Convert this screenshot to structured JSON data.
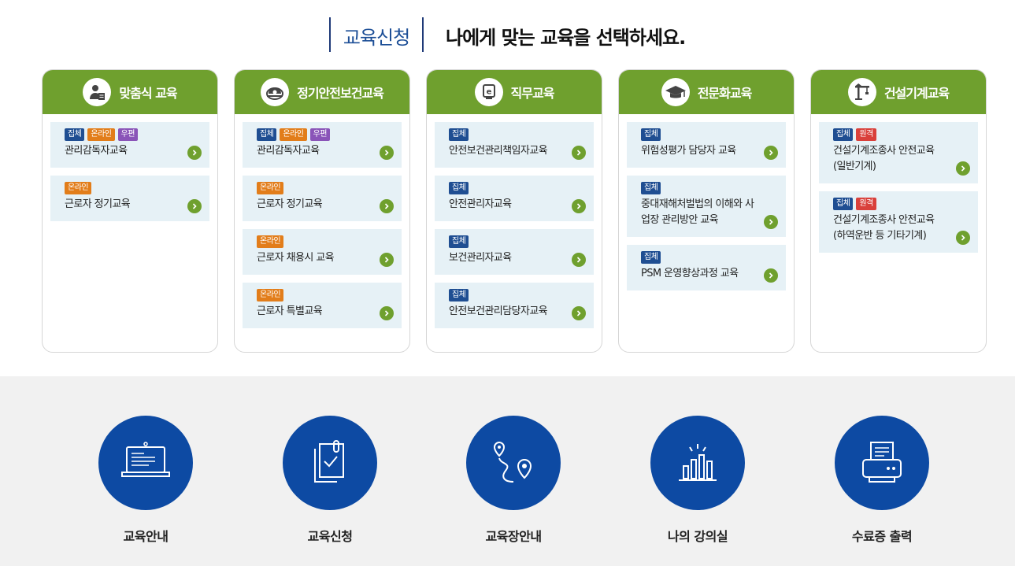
{
  "heading": {
    "label": "교육신청",
    "title": "나에게 맞는 교육을 선택하세요."
  },
  "colors": {
    "accent_green": "#6fa02e",
    "navy": "#1f4e92",
    "orange": "#e27d1a",
    "purple": "#8a54b8",
    "red": "#d9403b",
    "item_bg": "#e6f1f6",
    "circle_blue": "#0d4aa3"
  },
  "cards": [
    {
      "title": "맞춤식 교육",
      "icon": "person-document-icon",
      "items": [
        {
          "badges": [
            "집체",
            "온라인",
            "우편"
          ],
          "text": "관리감독자교육"
        },
        {
          "badges": [
            "온라인"
          ],
          "text": "근로자 정기교육"
        }
      ]
    },
    {
      "title": "정기안전보건교육",
      "icon": "safety-helmet-icon",
      "items": [
        {
          "badges": [
            "집체",
            "온라인",
            "우편"
          ],
          "text": "관리감독자교육"
        },
        {
          "badges": [
            "온라인"
          ],
          "text": "근로자 정기교육"
        },
        {
          "badges": [
            "온라인"
          ],
          "text": "근로자 채용시 교육"
        },
        {
          "badges": [
            "온라인"
          ],
          "text": "근로자 특별교육"
        }
      ]
    },
    {
      "title": "직무교육",
      "icon": "monitor-e-icon",
      "items": [
        {
          "badges": [
            "집체"
          ],
          "text": "안전보건관리책임자교육"
        },
        {
          "badges": [
            "집체"
          ],
          "text": "안전관리자교육"
        },
        {
          "badges": [
            "집체"
          ],
          "text": "보건관리자교육"
        },
        {
          "badges": [
            "집체"
          ],
          "text": "안전보건관리담당자교육"
        }
      ]
    },
    {
      "title": "전문화교육",
      "icon": "graduation-cap-icon",
      "items": [
        {
          "badges": [
            "집체"
          ],
          "text": "위험성평가 담당자 교육"
        },
        {
          "badges": [
            "집체"
          ],
          "text": "중대재해처벌법의 이해와 사업장 관리방안 교육"
        },
        {
          "badges": [
            "집체"
          ],
          "text": "PSM 운영향상과정 교육"
        }
      ]
    },
    {
      "title": "건설기계교육",
      "icon": "crane-icon",
      "items": [
        {
          "badges": [
            "집체",
            "원격"
          ],
          "text": "건설기계조종사 안전교육 (일반기계)"
        },
        {
          "badges": [
            "집체",
            "원격"
          ],
          "text": "건설기계조종사 안전교육 (하역운반 등 기타기계)"
        }
      ]
    }
  ],
  "quick_links": [
    {
      "label": "교육안내",
      "icon": "laptop-icon"
    },
    {
      "label": "교육신청",
      "icon": "clipboard-check-icon"
    },
    {
      "label": "교육장안내",
      "icon": "map-route-icon"
    },
    {
      "label": "나의 강의실",
      "icon": "bar-chart-icon"
    },
    {
      "label": "수료증 출력",
      "icon": "printer-icon"
    }
  ]
}
